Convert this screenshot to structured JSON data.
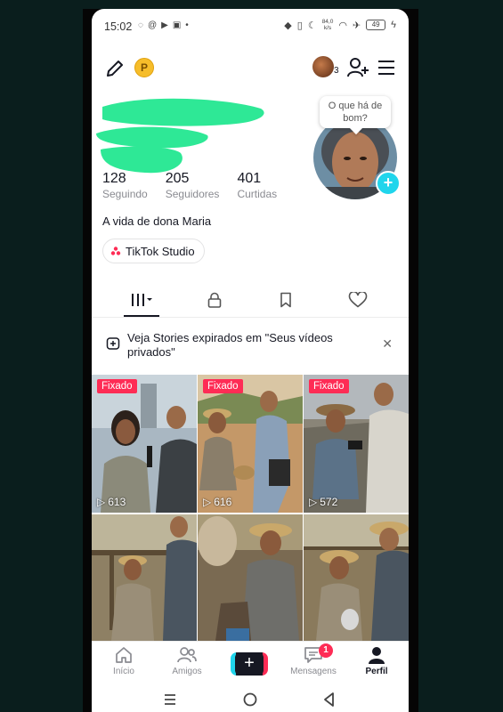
{
  "status_bar": {
    "time": "15:02",
    "network_speed_value": "84,0",
    "network_speed_unit": "k/s",
    "battery": "49"
  },
  "header": {
    "coin_label": "P",
    "notification_count": "3"
  },
  "profile": {
    "stats": [
      {
        "value": "128",
        "label": "Seguindo"
      },
      {
        "value": "205",
        "label": "Seguidores"
      },
      {
        "value": "401",
        "label": "Curtidas"
      }
    ],
    "bio": "A vida de dona Maria",
    "studio_label": "TikTok Studio",
    "bubble_text": "O que há de bom?"
  },
  "stories_banner": {
    "text": "Veja Stories expirados em \"Seus vídeos privados\""
  },
  "videos": [
    {
      "pinned_label": "Fixado",
      "views": "613"
    },
    {
      "pinned_label": "Fixado",
      "views": "616"
    },
    {
      "pinned_label": "Fixado",
      "views": "572"
    },
    {
      "pinned_label": "",
      "views": ""
    },
    {
      "pinned_label": "",
      "views": ""
    },
    {
      "pinned_label": "",
      "views": ""
    }
  ],
  "bottom_nav": {
    "items": [
      {
        "label": "Início",
        "icon": "home-icon"
      },
      {
        "label": "Amigos",
        "icon": "friends-icon"
      },
      {
        "label": "",
        "icon": "create-icon"
      },
      {
        "label": "Mensagens",
        "icon": "inbox-icon",
        "badge": "1"
      },
      {
        "label": "Perfil",
        "icon": "profile-icon"
      }
    ]
  },
  "colors": {
    "accent": "#fe2c55",
    "cyan": "#20d5ec",
    "redaction": "#2ee896"
  }
}
